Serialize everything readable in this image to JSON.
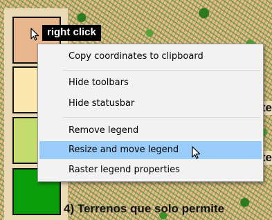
{
  "tooltip": {
    "text": "right click"
  },
  "context_menu": {
    "items": [
      {
        "label": "Copy coordinates to clipboard",
        "highlighted": false
      },
      {
        "label": "Hide toolbars",
        "highlighted": false
      },
      {
        "label": "Hide statusbar",
        "highlighted": false
      },
      {
        "label": "Remove legend",
        "highlighted": false
      },
      {
        "label": "Resize and move legend",
        "highlighted": true
      },
      {
        "label": "Raster legend properties",
        "highlighted": false
      }
    ]
  },
  "legend": {
    "swatch_colors": [
      "#e8b68c",
      "#fbe6ad",
      "#c4dc6e",
      "#0b9c0b"
    ],
    "partial_label_4": "4) Terrenos que solo permite",
    "partial_label_2_tail": "te",
    "partial_label_3_tail": "te"
  },
  "colors": {
    "highlight": "#99ccf9",
    "menu_background": "#f2f2f2",
    "tooltip_background": "#000000"
  }
}
